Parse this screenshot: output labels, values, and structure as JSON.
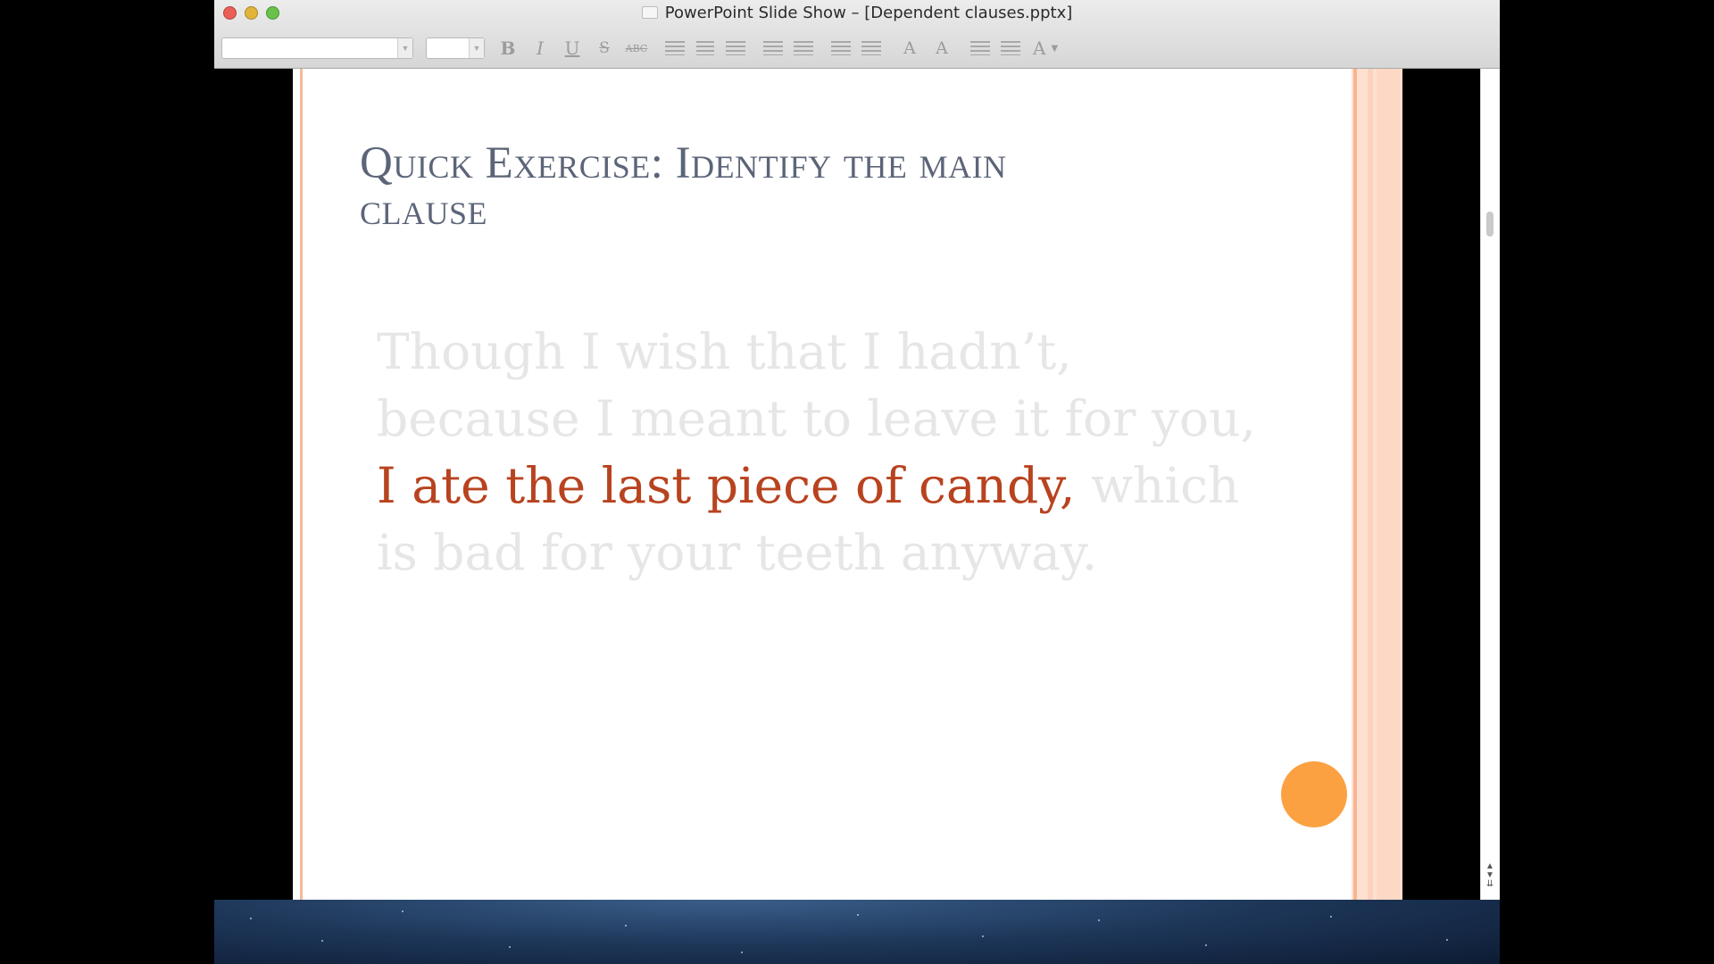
{
  "window": {
    "title": "PowerPoint Slide Show – [Dependent clauses.pptx]"
  },
  "toolbar": {
    "font_name": "",
    "font_size": "",
    "bold": "B",
    "italic": "I",
    "underline": "U",
    "strikethrough": "S",
    "abc": "ABC",
    "grow_font": "A",
    "shrink_font": "A",
    "font_color": "A",
    "icons": [
      "align-left-icon",
      "align-center-icon",
      "align-right-icon",
      "bullets-icon",
      "numbering-icon",
      "line-spacing-icon",
      "paragraph-spacing-icon",
      "decrease-indent-icon",
      "increase-indent-icon"
    ]
  },
  "slide": {
    "title_line1": "Quick Exercise: Identify the main",
    "title_line2": "clause",
    "body_before": "Though I wish that I hadn’t, because I meant to leave it for you, ",
    "body_main": "I ate the last piece of candy,",
    "body_after": " which is bad for your teeth anyway.",
    "colors": {
      "title": "#5c6578",
      "faded_text": "#e6e6e6",
      "main_clause": "#b8431f",
      "accent_dot": "#fba142"
    }
  }
}
